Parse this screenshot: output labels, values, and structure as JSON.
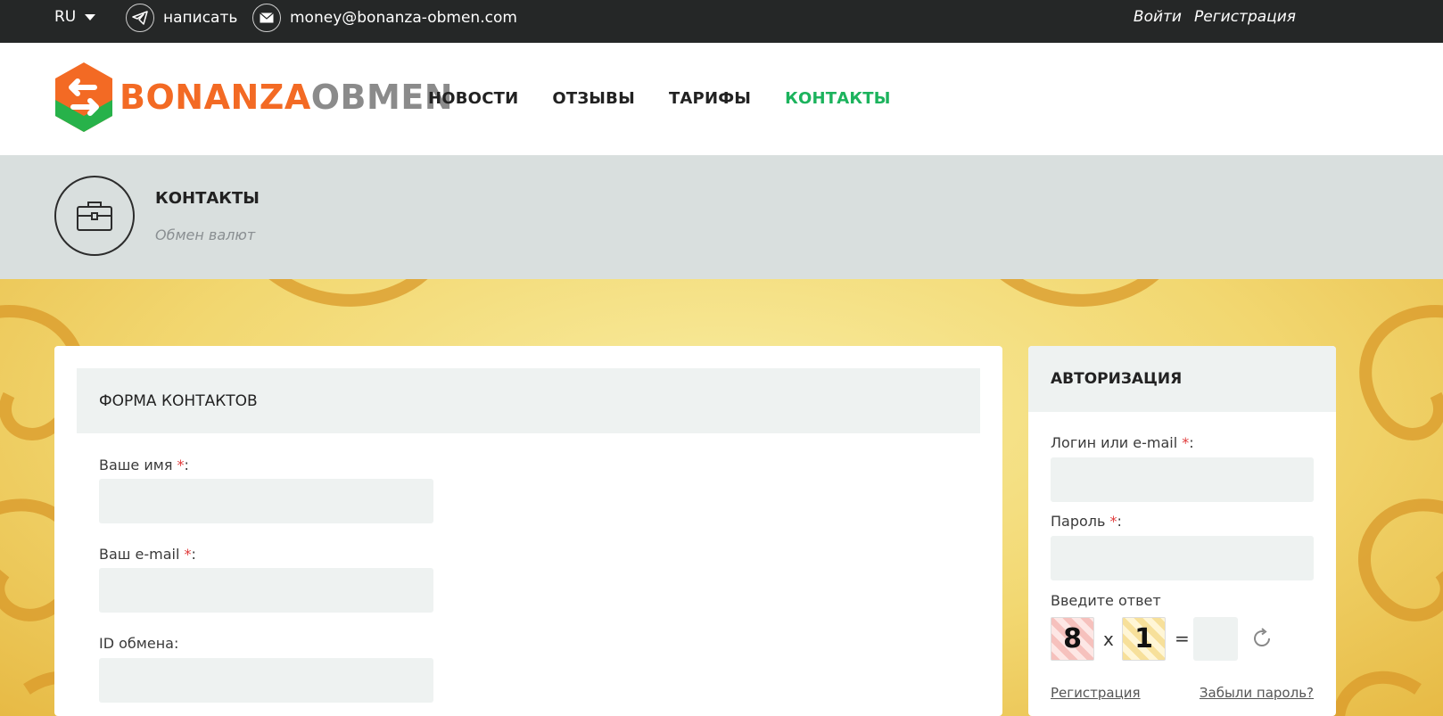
{
  "topbar": {
    "language": "RU",
    "telegram_label": "написать",
    "email_label": "money@bonanza-obmen.com",
    "login_link": "Войти",
    "register_link": "Регистрация"
  },
  "logo": {
    "part1": "BONANZA",
    "part2": "OBMEN"
  },
  "nav": {
    "items": [
      {
        "label": "НОВОСТИ"
      },
      {
        "label": "ОТЗЫВЫ"
      },
      {
        "label": "ТАРИФЫ"
      },
      {
        "label": "КОНТАКТЫ",
        "active": true
      }
    ],
    "active_color": "#1cb35d"
  },
  "page_header": {
    "title": "КОНТАКТЫ",
    "subtitle": "Обмен валют"
  },
  "contact_form": {
    "title": "ФОРМА КОНТАКТОВ",
    "fields": [
      {
        "label": "Ваше имя",
        "required": true,
        "value": ""
      },
      {
        "label": "Ваш e-mail",
        "required": true,
        "value": ""
      },
      {
        "label": "ID обмена",
        "required": false,
        "value": ""
      }
    ]
  },
  "auth": {
    "title": "АВТОРИЗАЦИЯ",
    "login_label": "Логин или e-mail",
    "password_label": "Пароль",
    "captcha_label": "Введите ответ",
    "captcha_a": "8",
    "captcha_op": "x",
    "captcha_b": "1",
    "captcha_eq": "=",
    "register_link": "Регистрация",
    "forgot_link": "Забыли пароль?"
  },
  "colors": {
    "topbar": "#252727",
    "accent_orange": "#f36a24",
    "accent_green": "#1cb35d",
    "required": "#e03a3a"
  }
}
